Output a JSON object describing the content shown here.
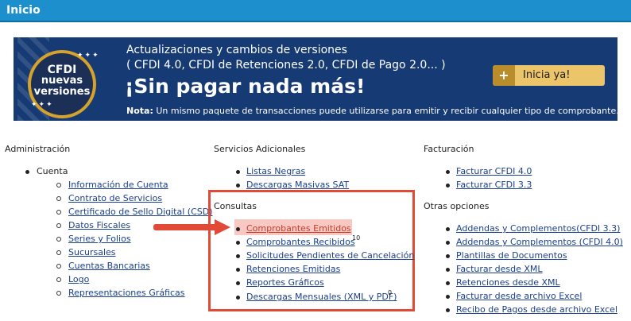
{
  "header": {
    "title": "Inicio"
  },
  "banner": {
    "line1": "Actualizaciones y cambios de versiones",
    "line2": "( CFDI 4.0, CFDI de Retenciones 2.0, CFDI de Pago 2.0... )",
    "headline": "¡Sin pagar nada más!",
    "note_label": "Nota:",
    "note_text": " Un mismo paquete de transacciones puede utilizarse para emitir y recibir cualquier tipo de comprobante.",
    "badge": [
      "CFDI",
      "nuevas",
      "versiones"
    ],
    "button_plus": "+",
    "button_label": "Inicia ya!",
    "colors": {
      "background": "#163a74",
      "gold": "#ecc46a"
    }
  },
  "administracion": {
    "title": "Administración",
    "cuenta": "Cuenta",
    "items": [
      "Información de Cuenta",
      "Contrato de Servicios",
      "Certificado de Sello Digital (CSD)",
      "Datos Fiscales",
      "Series y Folios",
      "Sucursales",
      "Cuentas Bancarias",
      "Logo",
      "Representaciones Gráficas"
    ]
  },
  "servicios": {
    "title": "Servicios Adicionales",
    "items": [
      "Listas Negras",
      "Descargas Masivas SAT"
    ]
  },
  "consultas": {
    "title": "Consultas",
    "items": [
      "Comprobantes Emitidos",
      "Comprobantes Recibidos",
      "Solicitudes Pendientes de Cancelación",
      "Retenciones Emitidas",
      "Reportes Gráficos",
      "Descargas Mensuales (XML y PDF)"
    ],
    "recibidos_count": "10",
    "descargas_count": "0"
  },
  "facturacion": {
    "title": "Facturación",
    "items": [
      "Facturar CFDI 4.0",
      "Facturar CFDI 3.3"
    ]
  },
  "otras": {
    "title": "Otras opciones",
    "items": [
      "Addendas y Complementos(CFDI 3.3)",
      "Addendas y Complementos (CFDI 4.0)",
      "Plantillas de Documentos",
      "Facturar desde XML",
      "Retenciones desde XML",
      "Facturar desde archivo Excel",
      "Recibo de Pagos desde archivo Excel"
    ]
  },
  "colors": {
    "header": "#1e8fcd",
    "link": "#1a3f8c",
    "annotation": "#e04a37"
  }
}
